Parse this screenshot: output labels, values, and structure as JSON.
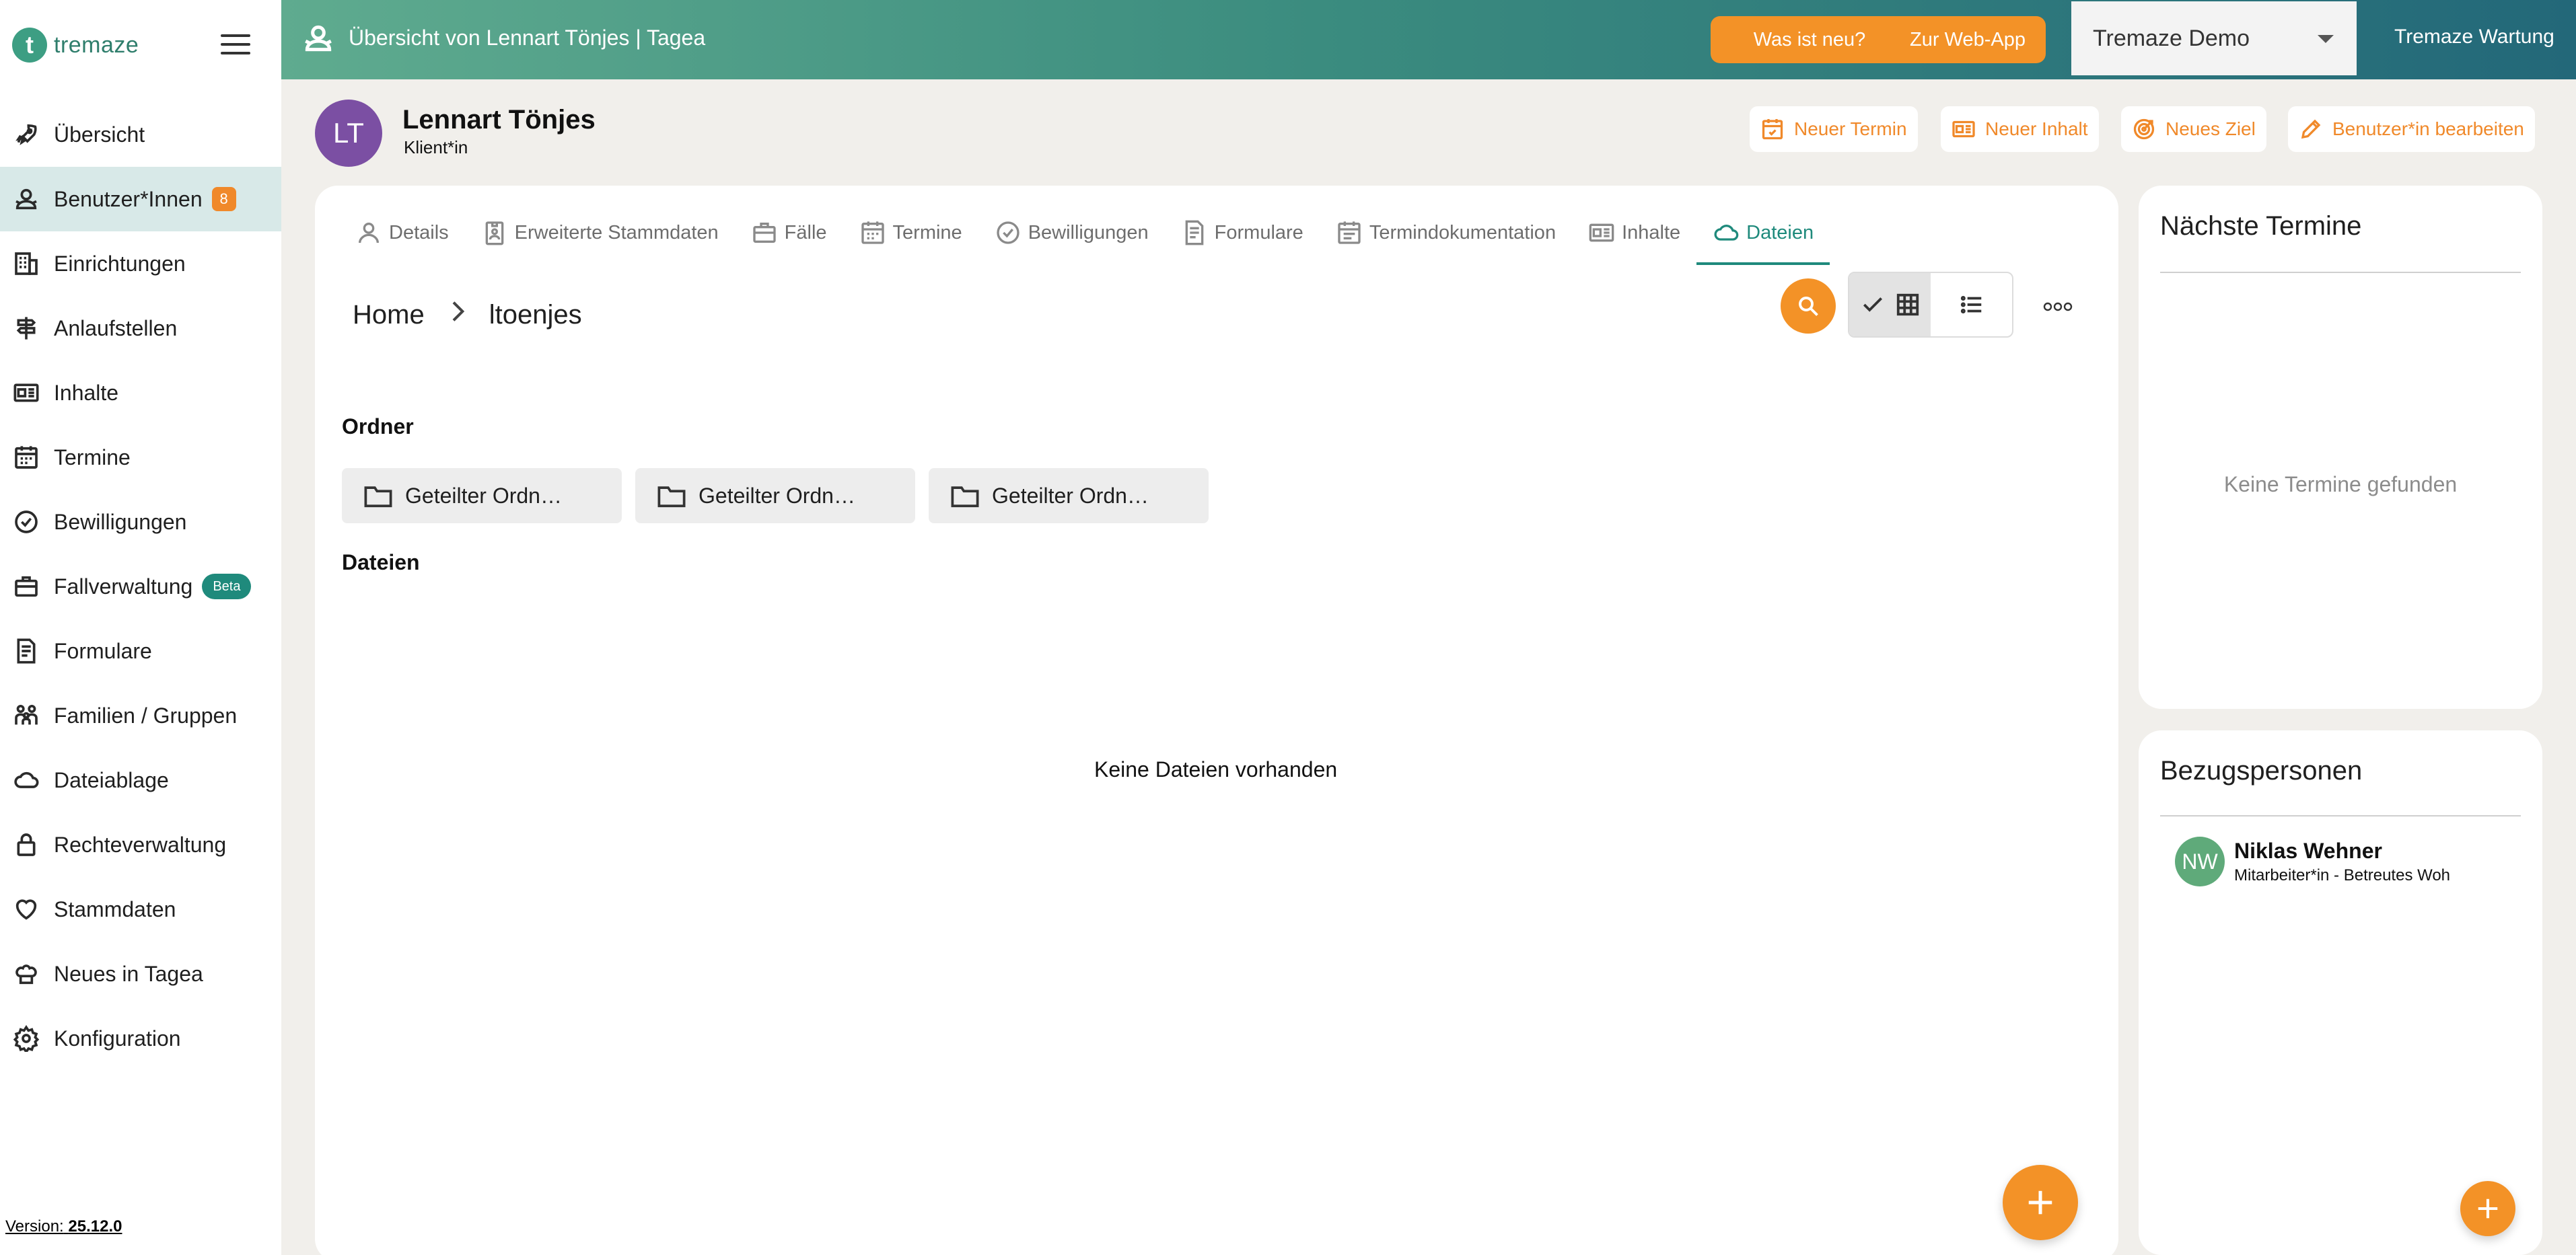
{
  "app": {
    "logo_letter": "t",
    "logo_text": "tremaze",
    "version_prefix": "Version:",
    "version": "25.12.0"
  },
  "sidebar": {
    "items": [
      {
        "label": "Übersicht",
        "icon": "rocket-icon"
      },
      {
        "label": "Benutzer*Innen",
        "icon": "users-icon",
        "badge": "8",
        "active": true
      },
      {
        "label": "Einrichtungen",
        "icon": "building-icon"
      },
      {
        "label": "Anlaufstellen",
        "icon": "signpost-icon"
      },
      {
        "label": "Inhalte",
        "icon": "newspaper-icon"
      },
      {
        "label": "Termine",
        "icon": "calendar-icon"
      },
      {
        "label": "Bewilligungen",
        "icon": "check-circle-icon"
      },
      {
        "label": "Fallverwaltung",
        "icon": "briefcase-icon",
        "beta": "Beta"
      },
      {
        "label": "Formulare",
        "icon": "form-icon"
      },
      {
        "label": "Familien / Gruppen",
        "icon": "family-icon"
      },
      {
        "label": "Dateiablage",
        "icon": "cloud-icon"
      },
      {
        "label": "Rechteverwaltung",
        "icon": "lock-icon"
      },
      {
        "label": "Stammdaten",
        "icon": "heart-icon"
      },
      {
        "label": "Neues in Tagea",
        "icon": "chef-hat-icon"
      },
      {
        "label": "Konfiguration",
        "icon": "gear-icon"
      }
    ]
  },
  "topbar": {
    "title": "Übersicht von Lennart Tönjes | Tagea",
    "whats_new": "Was ist neu?",
    "web_app": "Zur Web-App",
    "tenant": "Tremaze Demo",
    "maintenance": "Tremaze Wartung"
  },
  "profile": {
    "initials": "LT",
    "name": "Lennart Tönjes",
    "role": "Klient*in",
    "actions": {
      "new_appointment": "Neuer Termin",
      "new_content": "Neuer Inhalt",
      "new_goal": "Neues Ziel",
      "edit_user": "Benutzer*in bearbeiten"
    }
  },
  "tabs": [
    {
      "label": "Details",
      "icon": "person-icon"
    },
    {
      "label": "Erweiterte Stammdaten",
      "icon": "id-badge-icon"
    },
    {
      "label": "Fälle",
      "icon": "briefcase-icon"
    },
    {
      "label": "Termine",
      "icon": "calendar-icon"
    },
    {
      "label": "Bewilligungen",
      "icon": "check-circle-icon"
    },
    {
      "label": "Formulare",
      "icon": "form-icon"
    },
    {
      "label": "Termindokumentation",
      "icon": "calendar-doc-icon"
    },
    {
      "label": "Inhalte",
      "icon": "newspaper-icon"
    },
    {
      "label": "Dateien",
      "icon": "cloud-icon",
      "active": true
    }
  ],
  "files": {
    "breadcrumb": [
      "Home",
      "ltoenjes"
    ],
    "folders_heading": "Ordner",
    "folders": [
      "Geteilter Ordn…",
      "Geteilter Ordn…",
      "Geteilter Ordn…"
    ],
    "files_heading": "Dateien",
    "empty_text": "Keine Dateien vorhanden"
  },
  "appointments_card": {
    "title": "Nächste Termine",
    "empty_text": "Keine Termine gefunden"
  },
  "contacts_card": {
    "title": "Bezugspersonen",
    "people": [
      {
        "initials": "NW",
        "name": "Niklas Wehner",
        "role": "Mitarbeiter*in - Betreutes Woh"
      }
    ]
  },
  "colors": {
    "accent_orange": "#f39227",
    "brand_teal": "#1f8a7c",
    "active_nav_bg": "#d8e9e8"
  }
}
